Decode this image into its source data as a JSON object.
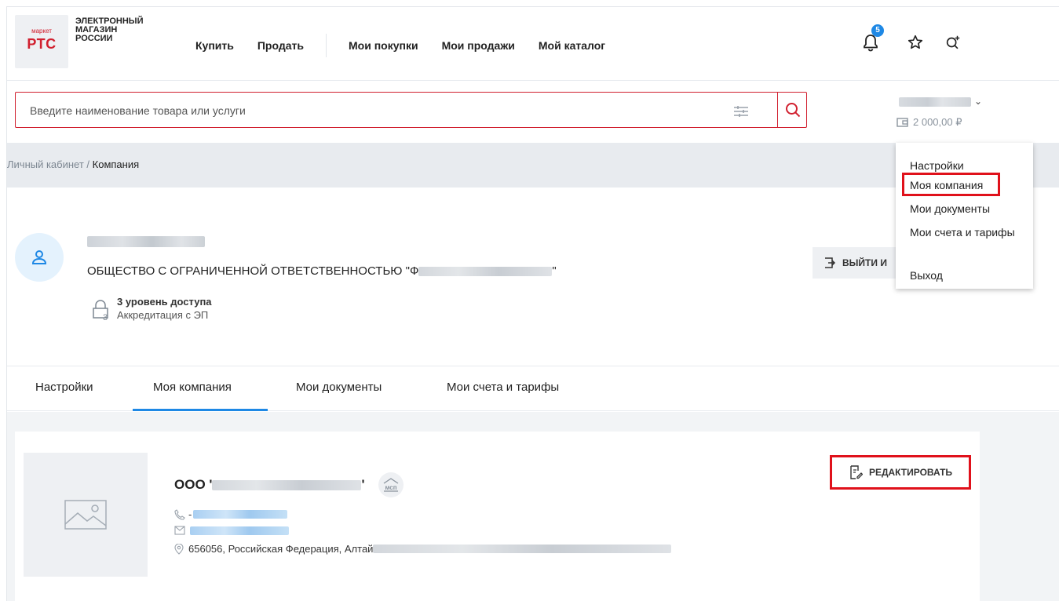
{
  "logo": {
    "market": "маркет",
    "brand": "РТС",
    "tagline": "ЭЛЕКТРОННЫЙ\nМАГАЗИН\nРОССИИ"
  },
  "nav": {
    "buy": "Купить",
    "sell": "Продать",
    "my_purchases": "Мои покупки",
    "my_sales": "Мои продажи",
    "my_catalog": "Мой каталог"
  },
  "notifications": {
    "count": "5"
  },
  "search": {
    "placeholder": "Введите наименование товара или услуги"
  },
  "account": {
    "balance": "2 000,00 ₽"
  },
  "breadcrumb": {
    "root": "Личный кабинет",
    "sep": " / ",
    "current": "Компания"
  },
  "user_menu": {
    "items": [
      "Настройки",
      "Моя компания",
      "Мои документы",
      "Мои счета и тарифы",
      "Выход"
    ],
    "highlighted": "Моя компания"
  },
  "profile": {
    "org_name_prefix": "ОБЩЕСТВО С ОГРАНИЧЕННОЙ ОТВЕТСТВЕННОСТЬЮ \"Ф",
    "org_name_suffix": "\"",
    "access_level_digit": "3",
    "access_level": "3 уровень доступа",
    "accreditation": "Аккредитация с ЭП",
    "exit_label": "ВЫЙТИ И"
  },
  "tabs": {
    "items": [
      "Настройки",
      "Моя компания",
      "Мои документы",
      "Мои счета и тарифы"
    ],
    "active": "Моя компания"
  },
  "company": {
    "short_name_prefix": "ООО '",
    "short_name_suffix": "'",
    "msp_badge": "мсп",
    "phone_prefix": "-",
    "address_prefix": "656056, Российская Федерация, Алтай",
    "edit_label": "РЕДАКТИРОВАТЬ"
  },
  "colors": {
    "brand_red": "#d1202f",
    "accent_blue": "#1e88e5",
    "highlight_red": "#e0111b"
  }
}
